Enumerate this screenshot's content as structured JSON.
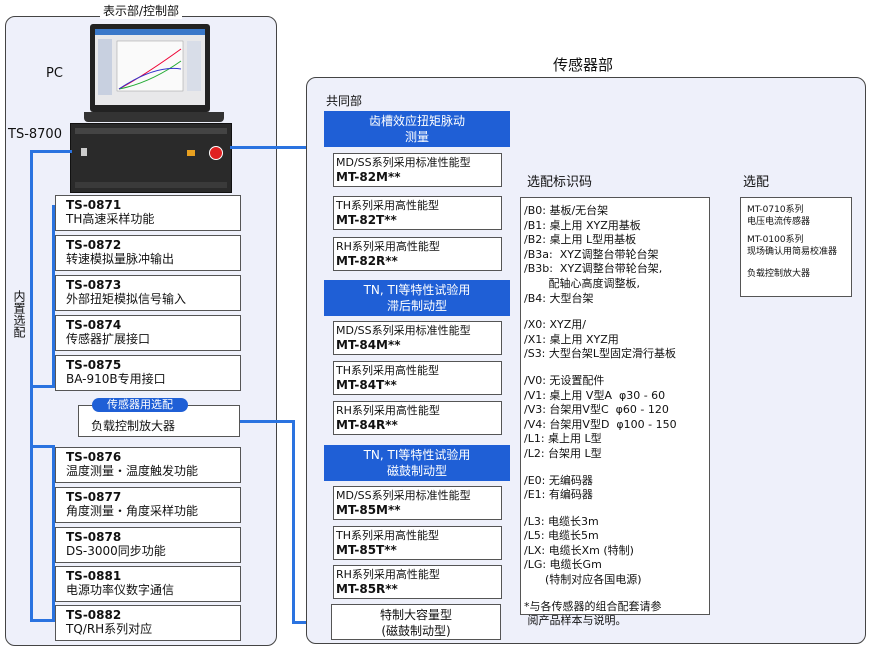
{
  "left_title": "表示部/控制部",
  "pc_label": "PC",
  "ts8700_label": "TS-8700",
  "builtin_label": "内置选配",
  "sensor_option_badge": "传感器用选配",
  "load_amp": "负载控制放大器",
  "modules": [
    {
      "code": "TS-0871",
      "desc": "TH高速采样功能"
    },
    {
      "code": "TS-0872",
      "desc": "转速模拟量脉冲输出"
    },
    {
      "code": "TS-0873",
      "desc": "外部扭矩模拟信号输入"
    },
    {
      "code": "TS-0874",
      "desc": "传感器扩展接口"
    },
    {
      "code": "TS-0875",
      "desc": "BA-910B专用接口"
    },
    {
      "code": "TS-0876",
      "desc": "温度测量・温度触发功能"
    },
    {
      "code": "TS-0877",
      "desc": "角度测量・角度采样功能"
    },
    {
      "code": "TS-0878",
      "desc": "DS-3000同步功能"
    },
    {
      "code": "TS-0881",
      "desc": "电源功率仪数字通信"
    },
    {
      "code": "TS-0882",
      "desc": "TQ/RH系列对应"
    }
  ],
  "right_title": "传感器部",
  "common_label": "共同部",
  "groups": [
    {
      "header": [
        "齿槽效应扭矩脉动",
        "测量"
      ],
      "items": [
        {
          "t1": "MD/SS系列采用标准性能型",
          "t2": "MT-82M**"
        },
        {
          "t1": "TH系列采用高性能型",
          "t2": "MT-82T**"
        },
        {
          "t1": "RH系列采用高性能型",
          "t2": "MT-82R**"
        }
      ]
    },
    {
      "header": [
        "TN, TI等特性试验用",
        "滞后制动型"
      ],
      "items": [
        {
          "t1": "MD/SS系列采用标准性能型",
          "t2": "MT-84M**"
        },
        {
          "t1": "TH系列采用高性能型",
          "t2": "MT-84T**"
        },
        {
          "t1": "RH系列采用高性能型",
          "t2": "MT-84R**"
        }
      ]
    },
    {
      "header": [
        "TN, TI等特性试验用",
        "磁鼓制动型"
      ],
      "items": [
        {
          "t1": "MD/SS系列采用标准性能型",
          "t2": "MT-85M**"
        },
        {
          "t1": "TH系列采用高性能型",
          "t2": "MT-85T**"
        },
        {
          "t1": "RH系列采用高性能型",
          "t2": "MT-85R**"
        }
      ]
    }
  ],
  "special": [
    "特制大容量型",
    "(磁鼓制动型)"
  ],
  "options_title": "选配标识码",
  "options_lines": [
    "/B0: 基板/无台架",
    "/B1: 桌上用 XYZ用基板",
    "/B2: 桌上用 L型用基板",
    "/B3a:  XYZ调整台带轮台架",
    "/B3b:  XYZ调整台带轮台架,",
    "       配轴心高度调整板,",
    "/B4: 大型台架",
    "",
    "/X0: XYZ用/",
    "/X1: 桌上用 XYZ用",
    "/S3: 大型台架L型固定滑行基板",
    "",
    "/V0: 无设置配件",
    "/V1: 桌上用 V型A  φ30 - 60",
    "/V3: 台架用V型C  φ60 - 120",
    "/V4: 台架用V型D  φ100 - 150",
    "/L1: 桌上用 L型",
    "/L2: 台架用 L型",
    "",
    "/E0: 无编码器",
    "/E1: 有编码器",
    "",
    "/L3: 电缆长3m",
    "/L5: 电缆长5m",
    "/LX: 电缆长Xm (特制)",
    "/LG: 电缆长Gm",
    "      (特制对应各国电源)",
    "",
    "*与各传感器的组合配套请参",
    " 阅产品样本与说明。"
  ],
  "select_title": "选配",
  "select_items": [
    [
      "MT-0710系列",
      "电压电流传感器"
    ],
    [
      "MT-0100系列",
      "现场确认用简易校准器"
    ],
    [
      "负载控制放大器"
    ]
  ],
  "colors": {
    "accent": "#1f5fd6",
    "line": "#2a73e0",
    "panel_bg": "#eef0fa"
  }
}
